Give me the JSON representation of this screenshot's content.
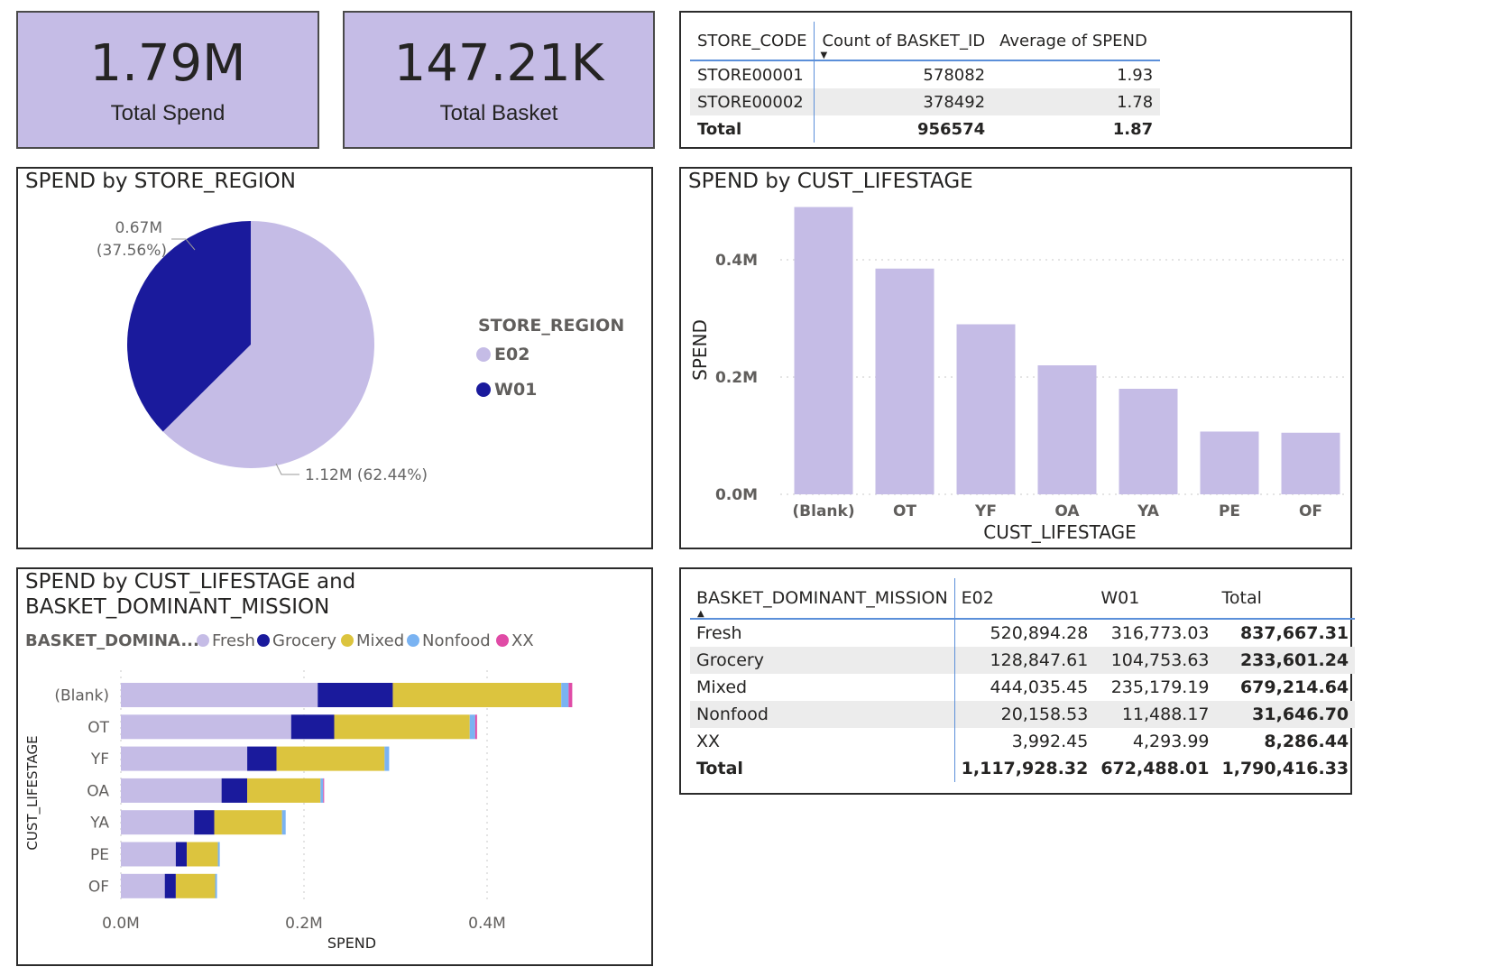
{
  "cards": [
    {
      "value": "1.79M",
      "label": "Total Spend"
    },
    {
      "value": "147.21K",
      "label": "Total Basket"
    }
  ],
  "store_table": {
    "headers": [
      "STORE_CODE",
      "Count of BASKET_ID",
      "Average of SPEND"
    ],
    "rows": [
      [
        "STORE00001",
        "578082",
        "1.93"
      ],
      [
        "STORE00002",
        "378492",
        "1.78"
      ]
    ],
    "total": [
      "Total",
      "956574",
      "1.87"
    ]
  },
  "mission_table": {
    "headers": [
      "BASKET_DOMINANT_MISSION",
      "E02",
      "W01",
      "Total"
    ],
    "rows": [
      [
        "Fresh",
        "520,894.28",
        "316,773.03",
        "837,667.31"
      ],
      [
        "Grocery",
        "128,847.61",
        "104,753.63",
        "233,601.24"
      ],
      [
        "Mixed",
        "444,035.45",
        "235,179.19",
        "679,214.64"
      ],
      [
        "Nonfood",
        "20,158.53",
        "11,488.17",
        "31,646.70"
      ],
      [
        "XX",
        "3,992.45",
        "4,293.99",
        "8,286.44"
      ]
    ],
    "total": [
      "Total",
      "1,117,928.32",
      "672,488.01",
      "1,790,416.33"
    ]
  },
  "colors": {
    "Fresh": "#c5bce6",
    "Grocery": "#1a1a9c",
    "Mixed": "#dcc43e",
    "Nonfood": "#7ab3f2",
    "XX": "#e04ba6",
    "E02": "#c5bce6",
    "W01": "#1a1a9c",
    "bar": "#c5bce6"
  },
  "chart_data": [
    {
      "type": "pie",
      "title": "SPEND by STORE_REGION",
      "legend_title": "STORE_REGION",
      "legend_position": "right",
      "slices": [
        {
          "name": "E02",
          "value": 1.12,
          "percent": 62.44,
          "label": "1.12M (62.44%)"
        },
        {
          "name": "W01",
          "value": 0.67,
          "percent": 37.56,
          "label_value": "0.67M",
          "label_pct": "(37.56%)"
        }
      ]
    },
    {
      "type": "bar",
      "title": "SPEND by CUST_LIFESTAGE",
      "xlabel": "CUST_LIFESTAGE",
      "ylabel": "SPEND",
      "categories": [
        "(Blank)",
        "OT",
        "YF",
        "OA",
        "YA",
        "PE",
        "OF"
      ],
      "values": [
        0.49,
        0.385,
        0.29,
        0.22,
        0.18,
        0.107,
        0.105
      ],
      "ylim": [
        0,
        0.5
      ],
      "yticks": [
        0,
        0.2,
        0.4
      ],
      "ytick_labels": [
        "0.0M",
        "0.2M",
        "0.4M"
      ],
      "grid": true
    },
    {
      "type": "bar",
      "orientation": "horizontal",
      "stacked": true,
      "title": "SPEND by CUST_LIFESTAGE and BASKET_DOMINANT_MISSION",
      "legend_title": "BASKET_DOMINA...",
      "legend_position": "top",
      "xlabel": "SPEND",
      "ylabel": "CUST_LIFESTAGE",
      "categories": [
        "(Blank)",
        "OT",
        "YF",
        "OA",
        "YA",
        "PE",
        "OF"
      ],
      "xlim": [
        0,
        0.5
      ],
      "xticks": [
        0,
        0.2,
        0.4
      ],
      "xtick_labels": [
        "0.0M",
        "0.2M",
        "0.4M"
      ],
      "grid": true,
      "series": [
        {
          "name": "Fresh",
          "values": [
            0.215,
            0.186,
            0.138,
            0.11,
            0.08,
            0.06,
            0.048
          ]
        },
        {
          "name": "Grocery",
          "values": [
            0.082,
            0.047,
            0.032,
            0.028,
            0.022,
            0.012,
            0.012
          ]
        },
        {
          "name": "Mixed",
          "values": [
            0.184,
            0.148,
            0.118,
            0.08,
            0.074,
            0.034,
            0.043
          ]
        },
        {
          "name": "Nonfood",
          "values": [
            0.008,
            0.006,
            0.005,
            0.003,
            0.004,
            0.002,
            0.002
          ]
        },
        {
          "name": "XX",
          "values": [
            0.004,
            0.002,
            0.0,
            0.001,
            0.0,
            0.0,
            0.0
          ]
        }
      ]
    }
  ]
}
